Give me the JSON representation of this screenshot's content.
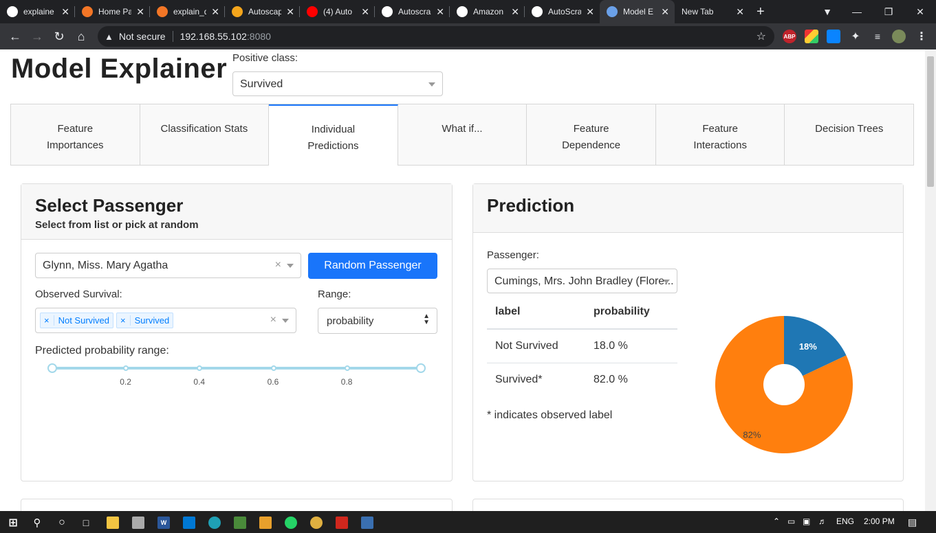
{
  "browser": {
    "tabs": [
      {
        "title": "explaine",
        "icon": "github-icon"
      },
      {
        "title": "Home Pa",
        "icon": "jupyter-icon"
      },
      {
        "title": "explain_d",
        "icon": "jupyter-x-icon"
      },
      {
        "title": "Autoscap",
        "icon": "notebook-icon"
      },
      {
        "title": "(4) Auto",
        "icon": "youtube-icon"
      },
      {
        "title": "Autoscra",
        "icon": "github-icon"
      },
      {
        "title": "Amazon",
        "icon": "amazon-icon"
      },
      {
        "title": "AutoScra",
        "icon": "github-icon"
      },
      {
        "title": "Model E",
        "icon": "chart-icon"
      },
      {
        "title": "New Tab",
        "icon": ""
      }
    ],
    "address": {
      "security": "Not secure",
      "host": "192.168.55.102",
      "port": ":8080"
    },
    "extensions": [
      "ABP"
    ]
  },
  "app": {
    "title": "Model Explainer",
    "positive_class_label": "Positive class:",
    "positive_class_value": "Survived"
  },
  "tabs": [
    {
      "line1": "Feature",
      "line2": "Importances"
    },
    {
      "line1": "Classification Stats",
      "line2": ""
    },
    {
      "line1": "Individual",
      "line2": "Predictions"
    },
    {
      "line1": "What if...",
      "line2": ""
    },
    {
      "line1": "Feature",
      "line2": "Dependence"
    },
    {
      "line1": "Feature",
      "line2": "Interactions"
    },
    {
      "line1": "Decision Trees",
      "line2": ""
    }
  ],
  "select_passenger": {
    "title": "Select Passenger",
    "subtitle": "Select from list or pick at random",
    "passenger_value": "Glynn, Miss. Mary Agatha",
    "random_button": "Random Passenger",
    "observed_label": "Observed Survival:",
    "observed_chips": [
      "Not Survived",
      "Survived"
    ],
    "range_label": "Range:",
    "range_value": "probability",
    "slider_label": "Predicted probability range:",
    "slider_ticks": [
      "0.2",
      "0.4",
      "0.6",
      "0.8"
    ],
    "slider_range": [
      0,
      1
    ]
  },
  "prediction": {
    "title": "Prediction",
    "passenger_label": "Passenger:",
    "passenger_value": "Cumings, Mrs. John Bradley (Flore...",
    "table_headers": [
      "label",
      "probability"
    ],
    "rows": [
      {
        "label": "Not Survived",
        "probability": "18.0 %"
      },
      {
        "label": "Survived*",
        "probability": "82.0 %"
      }
    ],
    "footnote": "* indicates observed label"
  },
  "chart_data": {
    "type": "pie",
    "categories": [
      "Not Survived",
      "Survived"
    ],
    "values": [
      18,
      82
    ],
    "labels": [
      "18%",
      "82%"
    ],
    "colors": [
      "#1f77b4",
      "#ff7f0e"
    ]
  },
  "taskbar": {
    "language": "ENG",
    "time": "2:00 PM"
  }
}
